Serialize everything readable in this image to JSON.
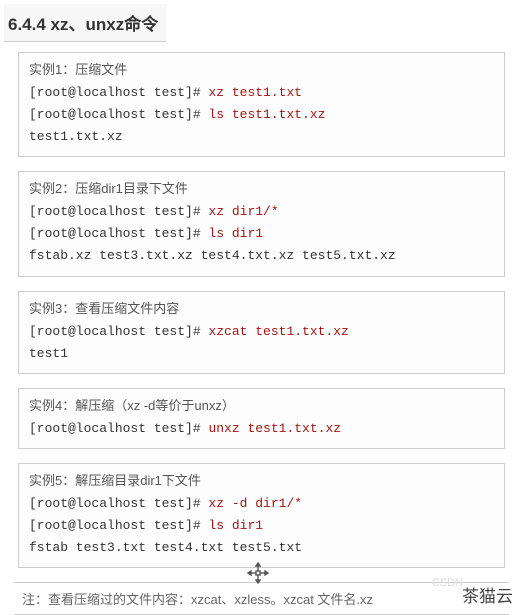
{
  "heading": "6.4.4 xz、unxz命令",
  "examples": [
    {
      "title": "实例1：压缩文件",
      "lines": [
        {
          "prompt": "[root@localhost test]# ",
          "cmd": "xz test1.txt"
        },
        {
          "prompt": "[root@localhost test]# ",
          "cmd": "ls test1.txt.xz"
        }
      ],
      "output": "test1.txt.xz"
    },
    {
      "title": "实例2：压缩dir1目录下文件",
      "lines": [
        {
          "prompt": "[root@localhost test]# ",
          "cmd": "xz dir1/*"
        },
        {
          "prompt": "[root@localhost test]# ",
          "cmd": "ls dir1"
        }
      ],
      "output": "fstab.xz  test3.txt.xz  test4.txt.xz  test5.txt.xz"
    },
    {
      "title": "实例3：查看压缩文件内容",
      "lines": [
        {
          "prompt": "[root@localhost test]# ",
          "cmd": "xzcat test1.txt.xz"
        }
      ],
      "output": "test1"
    },
    {
      "title": "实例4：解压缩（xz -d等价于unxz）",
      "lines": [
        {
          "prompt": "[root@localhost test]# ",
          "cmd": "unxz test1.txt.xz"
        }
      ],
      "output": ""
    },
    {
      "title": "实例5：解压缩目录dir1下文件",
      "lines": [
        {
          "prompt": "[root@localhost test]# ",
          "cmd": "xz -d dir1/*"
        },
        {
          "prompt": "[root@localhost test]# ",
          "cmd": "ls dir1"
        }
      ],
      "output": "fstab  test3.txt  test4.txt  test5.txt"
    }
  ],
  "footer": "注：查看压缩过的文件内容：xzcat、xzless。xzcat 文件名.xz",
  "watermark": "茶猫云",
  "wm_faint": "CSDN"
}
